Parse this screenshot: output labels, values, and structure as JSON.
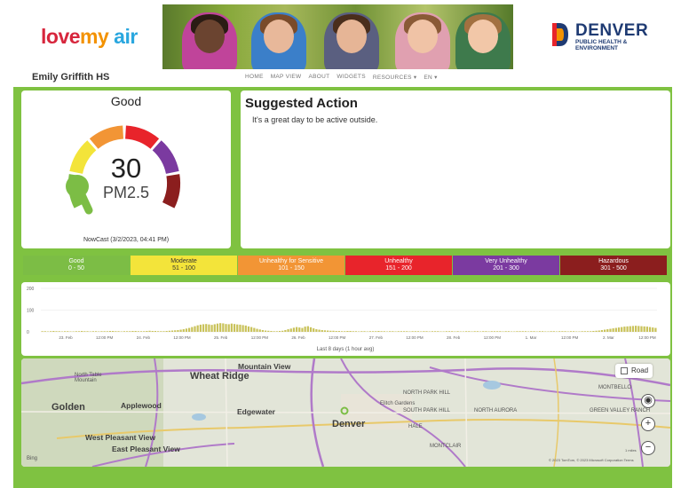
{
  "header": {
    "logo": {
      "love": "love",
      "my": "my",
      "air": "air"
    },
    "partner": {
      "title": "DENVER",
      "subtitle": "PUBLIC HEALTH & ENVIRONMENT"
    }
  },
  "nav": {
    "site_name": "Emily Griffith HS",
    "links": [
      "HOME",
      "MAP VIEW",
      "ABOUT",
      "WIDGETS",
      "RESOURCES ▾",
      "EN ▾"
    ]
  },
  "aqi": {
    "category": "Good",
    "value": "30",
    "pollutant": "PM2.5",
    "nowcast": "NowCast (3/2/2023, 04:41 PM)",
    "gauge_level": 0.06
  },
  "suggested_action": {
    "title": "Suggested Action",
    "text": "It's a great day to be active outside."
  },
  "scale": [
    {
      "label": "Good",
      "range": "0 - 50",
      "color": "#7cbd45",
      "text_color": "#ffffff"
    },
    {
      "label": "Moderate",
      "range": "51 - 100",
      "color": "#f3e43a",
      "text_color": "#333333"
    },
    {
      "label": "Unhealthy for Sensitive",
      "range": "101 - 150",
      "color": "#f29535",
      "text_color": "#ffffff"
    },
    {
      "label": "Unhealthy",
      "range": "151 - 200",
      "color": "#e8242b",
      "text_color": "#ffffff"
    },
    {
      "label": "Very Unhealthy",
      "range": "201 - 300",
      "color": "#7b3aa0",
      "text_color": "#ffffff"
    },
    {
      "label": "Hazardous",
      "range": "301 - 500",
      "color": "#8b1e1e",
      "text_color": "#ffffff"
    }
  ],
  "chart_data": {
    "type": "bar",
    "xlabel": "Last 8 days (1 hour avg)",
    "ylim": [
      0,
      200
    ],
    "yticks": [
      "200",
      "100",
      "0"
    ],
    "xticks": [
      "23. Feb",
      "12:00 PM",
      "24. Feb",
      "12:00 PM",
      "25. Feb",
      "12:00 PM",
      "26. Feb",
      "12:00 PM",
      "27. Feb",
      "12:00 PM",
      "28. Feb",
      "12:00 PM",
      "1. Mar",
      "12:00 PM",
      "2. Mar",
      "12:00 PM"
    ],
    "bar_color": "#c9c25a",
    "values": [
      3,
      3,
      2,
      3,
      4,
      3,
      3,
      2,
      3,
      3,
      2,
      2,
      3,
      3,
      4,
      3,
      3,
      2,
      3,
      3,
      2,
      3,
      3,
      3,
      4,
      4,
      3,
      3,
      2,
      3,
      3,
      3,
      4,
      4,
      3,
      3,
      3,
      4,
      5,
      4,
      4,
      3,
      3,
      3,
      4,
      5,
      6,
      7,
      8,
      10,
      12,
      15,
      18,
      22,
      26,
      30,
      33,
      35,
      36,
      34,
      32,
      35,
      38,
      40,
      39,
      36,
      35,
      38,
      36,
      34,
      33,
      31,
      29,
      25,
      22,
      18,
      14,
      11,
      8,
      6,
      5,
      4,
      3,
      3,
      4,
      5,
      8,
      12,
      15,
      19,
      22,
      20,
      18,
      24,
      26,
      21,
      16,
      12,
      10,
      8,
      7,
      6,
      5,
      5,
      4,
      4,
      3,
      3,
      4,
      4,
      3,
      3,
      2,
      3,
      3,
      2,
      3,
      3,
      3,
      4,
      3,
      3,
      2,
      3,
      3,
      2,
      3,
      3,
      3,
      3,
      2,
      3,
      3,
      3,
      2,
      3,
      3,
      2,
      3,
      3,
      3,
      2,
      2,
      3,
      3,
      3,
      2,
      3,
      2,
      2,
      3,
      3,
      2,
      3,
      3,
      2,
      3,
      3,
      2,
      3,
      3,
      3,
      3,
      2,
      3,
      3,
      2,
      2,
      3,
      3,
      3,
      3,
      2,
      3,
      3,
      2,
      3,
      3,
      2,
      2,
      3,
      3,
      2,
      3,
      3,
      3,
      2,
      3,
      3,
      2,
      2,
      3,
      3,
      3,
      3,
      4,
      5,
      6,
      8,
      10,
      12,
      14,
      16,
      18,
      20,
      22,
      24,
      25,
      26,
      27,
      28,
      27,
      26,
      25,
      24,
      22,
      20,
      18
    ],
    "title": ""
  },
  "map": {
    "road_button": "Road",
    "labels": [
      {
        "text": "Wheat Ridge",
        "size": "big"
      },
      {
        "text": "Mountain View",
        "size": "normal"
      },
      {
        "text": "Golden",
        "size": "big"
      },
      {
        "text": "Applewood",
        "size": "normal"
      },
      {
        "text": "Edgewater",
        "size": "normal"
      },
      {
        "text": "Denver",
        "size": "big"
      },
      {
        "text": "West Pleasant View",
        "size": "normal"
      },
      {
        "text": "East Pleasant View",
        "size": "normal"
      },
      {
        "text": "North Table Mountain",
        "size": "small"
      },
      {
        "text": "Elitch Gardens",
        "size": "small"
      },
      {
        "text": "NORTH PARK HILL",
        "size": "small"
      },
      {
        "text": "SOUTH PARK HILL",
        "size": "small"
      },
      {
        "text": "NORTH AURORA",
        "size": "small"
      },
      {
        "text": "MONTBELLO",
        "size": "small"
      },
      {
        "text": "GREEN VALLEY RANCH",
        "size": "small"
      },
      {
        "text": "HALE",
        "size": "small"
      },
      {
        "text": "MONTCLAIR",
        "size": "small"
      },
      {
        "text": "Bing",
        "size": "small"
      }
    ],
    "attribution": "© 2023 TomTom, © 2023 Microsoft Corporation Terms",
    "scale_text": "1 miles",
    "zoom_in": "+",
    "zoom_out": "−",
    "locate": "◉"
  },
  "colors": {
    "frame": "#7fc241",
    "denver_blue": "#1f3b73"
  }
}
